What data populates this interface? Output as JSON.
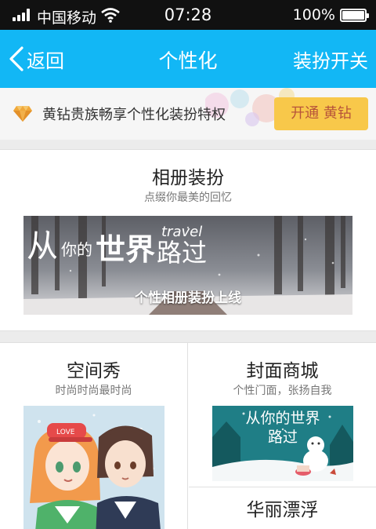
{
  "status_bar": {
    "carrier": "中国移动",
    "time": "07:28",
    "battery": "100%"
  },
  "nav": {
    "back_label": "返回",
    "title": "个性化",
    "right_action": "装扮开关"
  },
  "vip_banner": {
    "text": "黄钻贵族畅享个性化装扮特权",
    "button_label": "开通 黄钻",
    "icon": "diamond-icon"
  },
  "album": {
    "title": "相册装扮",
    "subtitle": "点缀你最美的回忆",
    "banner": {
      "headline_small": "从",
      "headline_mid": "你的",
      "headline_big": "世界",
      "headline_travel": "travel",
      "headline_end": "路过",
      "caption": "个性相册装扮上线"
    }
  },
  "space_show": {
    "title": "空间秀",
    "subtitle": "时尚时尚最时尚",
    "cap_text": "LOVE"
  },
  "cover_mall": {
    "title": "封面商城",
    "subtitle": "个性门面，张扬自我",
    "image_text_line1": "从你的世界",
    "image_text_line2": "路过"
  },
  "floating": {
    "title": "华丽漂浮"
  },
  "colors": {
    "nav": "#12b7f5",
    "vip_button": "#f8c84a",
    "vip_button_text": "#b7543a",
    "diamond": "#f0a83a"
  }
}
